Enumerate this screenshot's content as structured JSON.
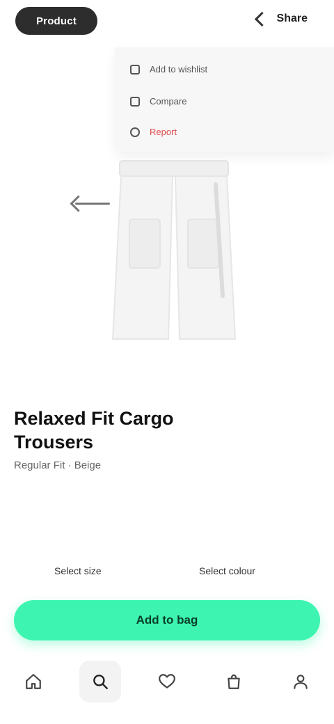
{
  "header": {
    "pill_label": "Product",
    "right_label": "Share"
  },
  "menu": {
    "items": [
      {
        "label": "Add to wishlist",
        "icon": "heart-icon"
      },
      {
        "label": "Compare",
        "icon": "compare-icon"
      },
      {
        "label": "Report",
        "icon": "flag-icon",
        "color": "#e04a4a"
      }
    ]
  },
  "product": {
    "title": "Relaxed Fit Cargo Trousers",
    "subtitle": "Regular Fit · Beige"
  },
  "options": {
    "left_label": "Select size",
    "right_label": "Select colour"
  },
  "cta": {
    "label": "Add to bag",
    "color": "#3df5b0"
  },
  "bottom_nav": {
    "items": [
      {
        "icon": "home-icon"
      },
      {
        "icon": "search-icon",
        "active": true
      },
      {
        "icon": "heart-icon"
      },
      {
        "icon": "bag-icon"
      },
      {
        "icon": "profile-icon"
      }
    ]
  }
}
